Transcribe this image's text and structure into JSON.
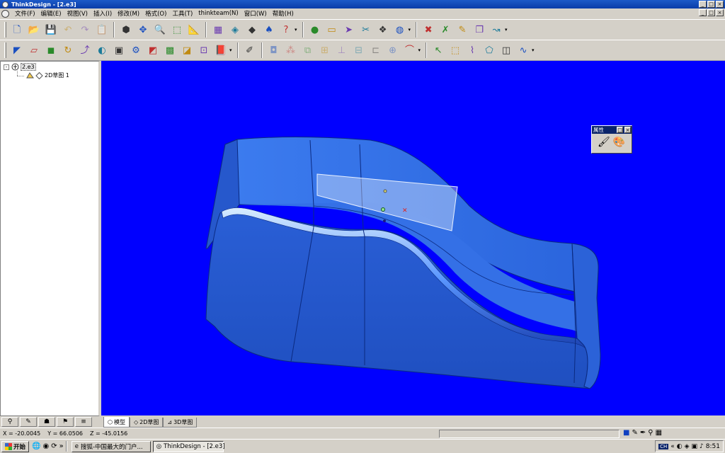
{
  "window": {
    "title": "ThinkDesign - [2.e3]",
    "minimize": "_",
    "maximize": "□",
    "close": "×"
  },
  "menu": [
    "文件(F)",
    "编辑(E)",
    "视图(V)",
    "插入(I)",
    "修改(M)",
    "格式(O)",
    "工具(T)",
    "thinkteam(N)",
    "窗口(W)",
    "帮助(H)"
  ],
  "toolbar1_icons": [
    "new-file-icon",
    "open-folder-icon",
    "save-icon",
    "undo-icon",
    "redo-icon",
    "clipboard-icon",
    "box-icon",
    "move-icon",
    "zoom-icon",
    "view-cube-icon",
    "measure-icon",
    "table-icon",
    "layer-icon",
    "shape-icon",
    "render-icon",
    "help-icon",
    "sphere-icon",
    "eraser-icon",
    "arrow-icon",
    "cut-icon",
    "cube-color-icon",
    "globe-icon",
    "delete-icon",
    "delete-all-icon",
    "pencil-erase-icon",
    "copy-icon",
    "curve-tool-icon"
  ],
  "toolbar2_icons": [
    "surface-icon",
    "plane-icon",
    "fill-icon",
    "sweep-icon",
    "loft-icon",
    "blend-icon",
    "solid-icon",
    "gear-icon",
    "shaded-icon",
    "mesh-icon",
    "cut-surface-icon",
    "offset-icon",
    "book-icon",
    "sketch-icon",
    "hole-icon",
    "pattern-icon",
    "mirror-icon",
    "dimension-icon",
    "constraint-icon",
    "align-icon",
    "frame-icon",
    "boolean-icon",
    "fillet-icon",
    "select-arrow-icon",
    "select-box-icon",
    "select-lasso-icon",
    "select-shape-icon",
    "select-face-icon",
    "curve-icon"
  ],
  "tree": {
    "root": "2.e3",
    "child": "2D草图 1",
    "expander": "-"
  },
  "tree_tools": [
    "⚲",
    "✎",
    "☗",
    "⚑",
    "≡"
  ],
  "properties": {
    "title": "属性",
    "pin": "□",
    "close": "×"
  },
  "tabs": {
    "model": "模型",
    "sketch2d": "2D草图",
    "sketch3d": "3D草图"
  },
  "status": {
    "x": "X = -20.0045",
    "y": "Y = 66.0506",
    "z": "Z = -45.0156"
  },
  "taskbar": {
    "start": "开始",
    "task1": "搜狐-中国最大的门户...",
    "task2": "ThinkDesign - [2.e3]",
    "ime": "CH",
    "time": "8:51",
    "chevron": "«",
    "ql_chevron": "»"
  },
  "colors": {
    "viewport": "#0000ff",
    "body": "#2c6ae0",
    "highlight": "#bfe0ff"
  }
}
